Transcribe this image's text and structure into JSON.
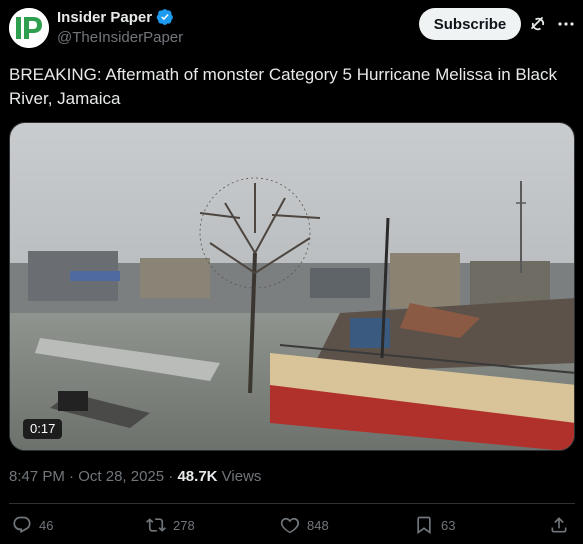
{
  "author": {
    "display_name": "Insider Paper",
    "handle": "@TheInsiderPaper",
    "avatar_letters": "IP",
    "verified_icon": "verified-badge-icon"
  },
  "header": {
    "subscribe_label": "Subscribe"
  },
  "tweet": {
    "text": "BREAKING: Aftermath of monster Category 5 Hurricane Melissa in Black River, Jamaica"
  },
  "media": {
    "duration": "0:17"
  },
  "meta": {
    "time": "8:47 PM",
    "dot1": "·",
    "date": "Oct 28, 2025",
    "dot2": "·",
    "views_count": "48.7K",
    "views_label": "Views"
  },
  "actions": {
    "replies": "46",
    "reposts": "278",
    "likes": "848",
    "bookmarks": "63"
  },
  "colors": {
    "background": "#000000",
    "text": "#e7e9ea",
    "muted": "#71767b",
    "verified": "#1d9bf0",
    "avatar_green": "#2e9e4f"
  }
}
